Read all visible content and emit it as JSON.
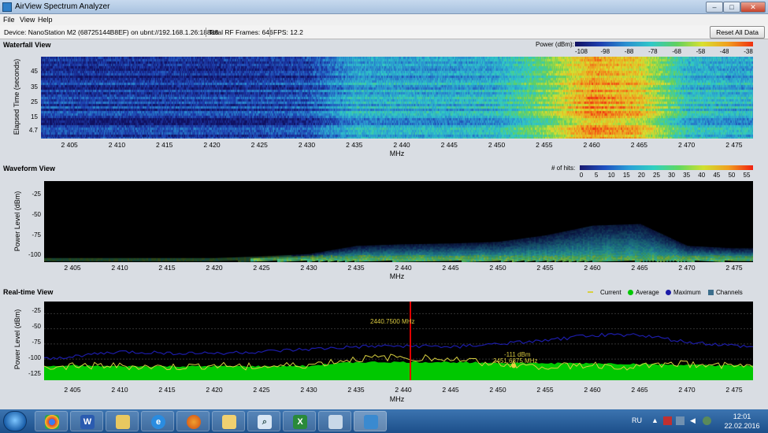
{
  "window": {
    "title": "AirView Spectrum Analyzer",
    "min": "–",
    "max": "□",
    "close": "✕"
  },
  "menu": [
    "File",
    "View",
    "Help"
  ],
  "info": {
    "device": "Device: NanoStation M2 (68725144B8EF) on ubnt://192.168.1.26:18888",
    "frames": "Total RF Frames: 646",
    "fps": "FPS: 12.2",
    "reset": "Reset All Data"
  },
  "colors": {
    "background": "#d9dde3",
    "plot_bg": "#000000",
    "current": "#d8d040",
    "average": "#00c800",
    "maximum": "#1c1ca8",
    "channels": "#3c6e8c",
    "marker": "#e00000"
  },
  "waterfall": {
    "title": "Waterfall View",
    "legend_title": "Power (dBm):",
    "legend_ticks": [
      "-108",
      "-98",
      "-88",
      "-78",
      "-68",
      "-58",
      "-48",
      "-38"
    ],
    "ylabel": "Elapsed Time (seconds)",
    "yticks": [
      "45",
      "35",
      "25",
      "15",
      "4.7"
    ],
    "xlabel": "MHz"
  },
  "waveform": {
    "title": "Waveform View",
    "legend_title": "# of hits:",
    "legend_ticks": [
      "0",
      "5",
      "10",
      "15",
      "20",
      "25",
      "30",
      "35",
      "40",
      "45",
      "50",
      "55"
    ],
    "ylabel": "Power Level (dBm)",
    "yticks": [
      "-25",
      "-50",
      "-75",
      "-100"
    ],
    "xlabel": "MHz"
  },
  "realtime": {
    "title": "Real-time View",
    "legend": [
      "Current",
      "Average",
      "Maximum",
      "Channels"
    ],
    "ylabel": "Power Level (dBm)",
    "yticks": [
      "-25",
      "-50",
      "-75",
      "-100",
      "-125"
    ],
    "xlabel": "MHz",
    "marker_label": "2440.7500 MHz",
    "point_label": "2451.6875 MHz",
    "point_label_db": "-111 dBm"
  },
  "xticks": [
    "2 405",
    "2 410",
    "2 415",
    "2 420",
    "2 425",
    "2 430",
    "2 435",
    "2 440",
    "2 445",
    "2 450",
    "2 455",
    "2 460",
    "2 465",
    "2 470",
    "2 475"
  ],
  "chart_data": [
    {
      "type": "heatmap",
      "title": "Waterfall View",
      "xlabel": "MHz",
      "ylabel": "Elapsed Time (seconds)",
      "xlim": [
        2402,
        2477
      ],
      "ylim": [
        0,
        52
      ],
      "colorbar": {
        "label": "Power (dBm):",
        "range": [
          -108,
          -38
        ]
      },
      "x": [
        2405,
        2410,
        2415,
        2420,
        2425,
        2430,
        2435,
        2440,
        2445,
        2450,
        2455,
        2460,
        2465,
        2470,
        2475
      ],
      "values_dbm": [
        -100,
        -100,
        -100,
        -100,
        -99,
        -97,
        -84,
        -84,
        -84,
        -82,
        -68,
        -48,
        -54,
        -80,
        -83
      ]
    },
    {
      "type": "heatmap",
      "title": "Waveform View",
      "xlabel": "MHz",
      "ylabel": "Power Level (dBm)",
      "xlim": [
        2402,
        2477
      ],
      "ylim": [
        -105,
        -5
      ],
      "colorbar": {
        "label": "# of hits:",
        "range": [
          0,
          55
        ]
      },
      "x": [
        2405,
        2410,
        2415,
        2420,
        2425,
        2430,
        2435,
        2440,
        2445,
        2450,
        2455,
        2460,
        2465,
        2470,
        2475
      ],
      "peak_dbm": [
        -100,
        -100,
        -100,
        -100,
        -98,
        -95,
        -85,
        -83,
        -82,
        -80,
        -72,
        -60,
        -58,
        -85,
        -88
      ]
    },
    {
      "type": "line",
      "title": "Real-time View",
      "xlabel": "MHz",
      "ylabel": "Power Level (dBm)",
      "xlim": [
        2402,
        2477
      ],
      "ylim": [
        -135,
        -5
      ],
      "x": [
        2403,
        2405,
        2410,
        2415,
        2420,
        2425,
        2430,
        2435,
        2440,
        2445,
        2450,
        2455,
        2460,
        2465,
        2470,
        2475,
        2477
      ],
      "series": [
        {
          "name": "Current",
          "values": [
            -115,
            -110,
            -112,
            -114,
            -111,
            -113,
            -110,
            -100,
            -97,
            -100,
            -108,
            -112,
            -110,
            -113,
            -108,
            -110,
            -112
          ]
        },
        {
          "name": "Average",
          "values": [
            -112,
            -111,
            -112,
            -112,
            -112,
            -112,
            -111,
            -105,
            -105,
            -105,
            -106,
            -107,
            -107,
            -108,
            -110,
            -111,
            -111
          ]
        },
        {
          "name": "Maximum",
          "values": [
            -100,
            -95,
            -88,
            -90,
            -90,
            -88,
            -84,
            -80,
            -78,
            -80,
            -75,
            -70,
            -60,
            -60,
            -72,
            -78,
            -80
          ]
        }
      ],
      "marker_x": 2440.75
    }
  ],
  "taskbar": {
    "lang": "RU",
    "time": "12:01",
    "date": "22.02.2016"
  }
}
